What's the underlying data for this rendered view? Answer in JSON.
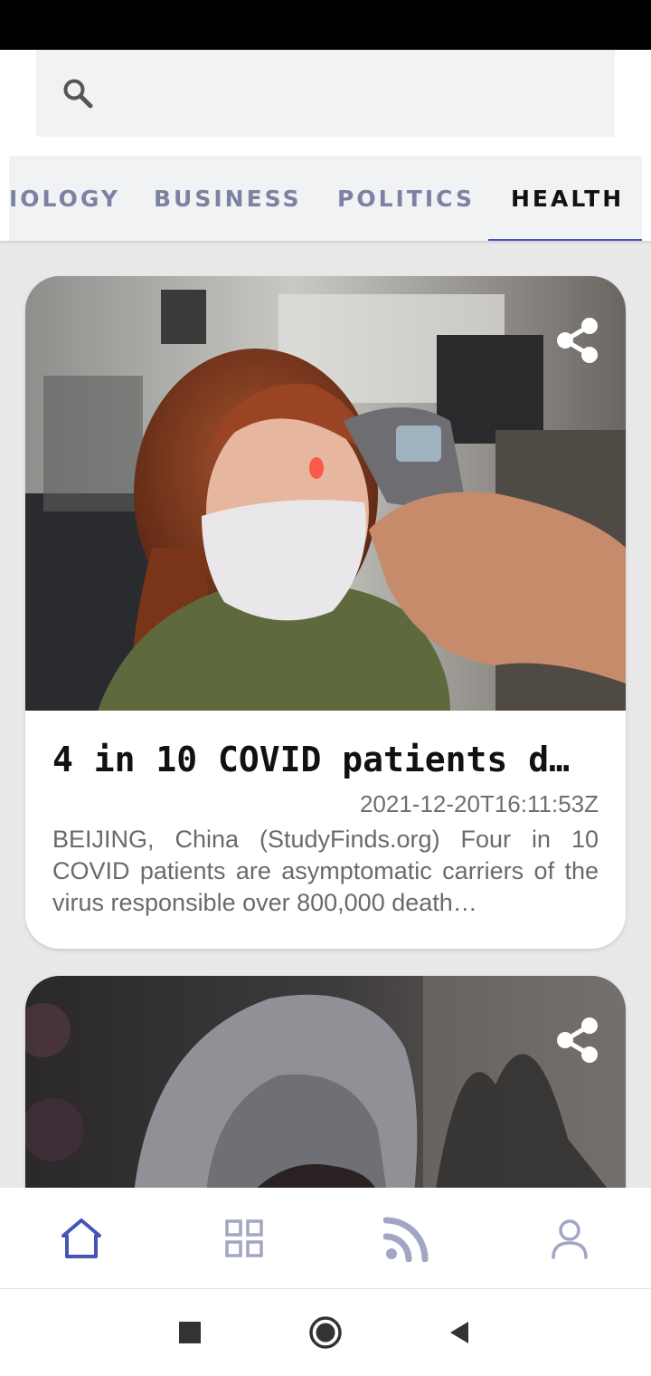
{
  "search": {
    "icon": "search-icon",
    "placeholder": ""
  },
  "tabs": {
    "items": [
      {
        "label": "IOLOGY"
      },
      {
        "label": "BUSINESS"
      },
      {
        "label": "POLITICS"
      },
      {
        "label": "HEALTH"
      }
    ],
    "active_label": "HEALTH",
    "active_color": "#111111",
    "inactive_color": "#7c82a2",
    "indicator_color": "#4654b8"
  },
  "articles": [
    {
      "title": "4 in 10 COVID patients d…",
      "date": "2021-12-20T16:11:53Z",
      "description": "BEIJING, China (StudyFinds.org) Four in 10 COVID patients are asymptomatic carriers of the virus responsible over 800,000 death…",
      "image_icon": "woman-temperature-check-photo",
      "share_icon": "share-icon"
    },
    {
      "title": "",
      "date": "",
      "description": "",
      "image_icon": "hooded-person-photo",
      "share_icon": "share-icon"
    }
  ],
  "bottom_nav": {
    "items": [
      {
        "icon": "home-icon",
        "active": true
      },
      {
        "icon": "grid-icon",
        "active": false
      },
      {
        "icon": "rss-feed-icon",
        "active": false
      },
      {
        "icon": "user-icon",
        "active": false
      }
    ],
    "active_color": "#4654b8",
    "inactive_color": "#a2a6c4"
  },
  "system_nav": {
    "items": [
      {
        "icon": "recent-apps-icon"
      },
      {
        "icon": "home-circle-icon"
      },
      {
        "icon": "back-icon"
      }
    ]
  }
}
